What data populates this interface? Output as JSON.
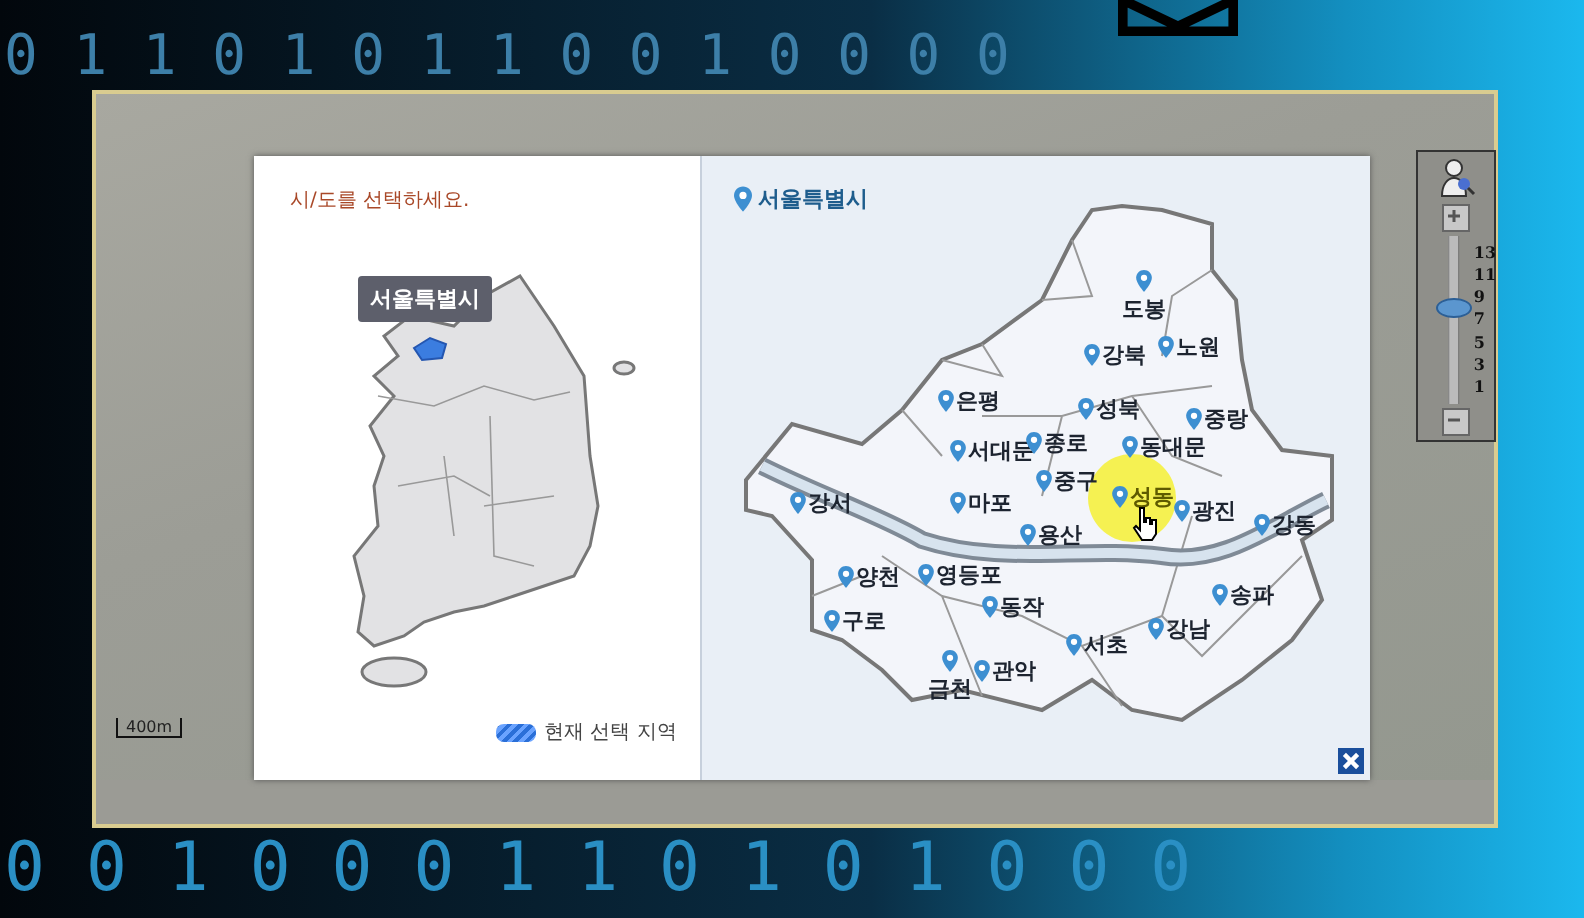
{
  "wallpaper": {
    "digits_top": "0 1 1 0 1 0 1 1 0 0 1 0 0 0 0",
    "digits_bottom": "0 0 1 0 0 0 1 1 0 1 0 1 0 0 0"
  },
  "map_window": {
    "scale": "400m",
    "zoom_control": {
      "level": 0.57,
      "ticks": [
        "13",
        "11",
        "9",
        "7",
        "5",
        "3",
        "1"
      ]
    }
  },
  "region_dialog": {
    "prompt": "시/도를 선택하세요.",
    "tooltip": "서울특별시",
    "legend": "현재 선택 지역",
    "district_title": "서울특별시",
    "districts": [
      {
        "name": "도봉",
        "selected": false
      },
      {
        "name": "강북",
        "selected": false
      },
      {
        "name": "노원",
        "selected": false
      },
      {
        "name": "은평",
        "selected": false
      },
      {
        "name": "성북",
        "selected": false
      },
      {
        "name": "중랑",
        "selected": false
      },
      {
        "name": "서대문",
        "selected": false
      },
      {
        "name": "종로",
        "selected": false
      },
      {
        "name": "동대문",
        "selected": false
      },
      {
        "name": "중구",
        "selected": false
      },
      {
        "name": "강서",
        "selected": false
      },
      {
        "name": "마포",
        "selected": false
      },
      {
        "name": "성동",
        "selected": true
      },
      {
        "name": "광진",
        "selected": false
      },
      {
        "name": "강동",
        "selected": false
      },
      {
        "name": "용산",
        "selected": false
      },
      {
        "name": "양천",
        "selected": false
      },
      {
        "name": "영등포",
        "selected": false
      },
      {
        "name": "송파",
        "selected": false
      },
      {
        "name": "동작",
        "selected": false
      },
      {
        "name": "구로",
        "selected": false
      },
      {
        "name": "강남",
        "selected": false
      },
      {
        "name": "서초",
        "selected": false
      },
      {
        "name": "관악",
        "selected": false
      },
      {
        "name": "금천",
        "selected": false
      }
    ]
  }
}
